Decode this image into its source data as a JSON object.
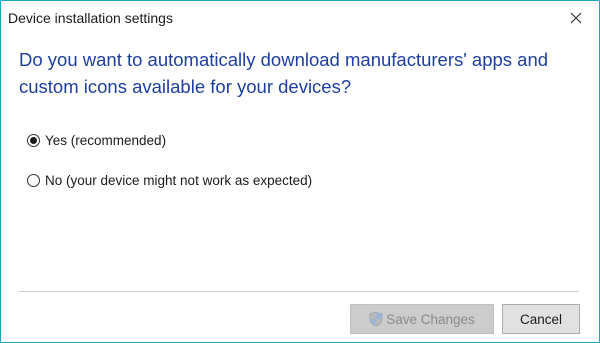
{
  "window": {
    "title": "Device installation settings"
  },
  "question": "Do you want to automatically download manufacturers' apps and custom icons available for your devices?",
  "options": [
    {
      "label": "Yes (recommended)",
      "selected": true
    },
    {
      "label": "No (your device might not work as expected)",
      "selected": false
    }
  ],
  "buttons": {
    "save_label": "Save Changes",
    "save_enabled": false,
    "cancel_label": "Cancel"
  },
  "icons": {
    "close": "close-icon",
    "shield": "uac-shield-icon"
  },
  "colors": {
    "accent_border": "#1aa6c4",
    "question_text": "#1e3fa0"
  }
}
